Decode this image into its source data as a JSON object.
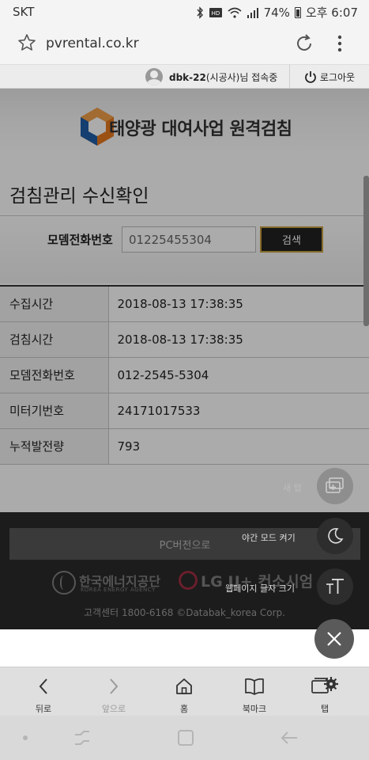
{
  "status_bar": {
    "carrier": "SKT",
    "battery": "74%",
    "time": "오후 6:07"
  },
  "browser": {
    "url": "pvrental.co.kr"
  },
  "user_bar": {
    "user_id": "dbk-22",
    "user_role_suffix": "(시공사)님 접속중",
    "logout_label": "로그아웃"
  },
  "header": {
    "logo_text": "태양광 대여사업 원격검침"
  },
  "page": {
    "title": "검침관리 수신확인"
  },
  "search": {
    "label": "모뎀전화번호",
    "value": "01225455304",
    "button_label": "검색"
  },
  "info_rows": [
    {
      "label": "수집시간",
      "value": "2018-08-13 17:38:35"
    },
    {
      "label": "검침시간",
      "value": "2018-08-13 17:38:35"
    },
    {
      "label": "모뎀전화번호",
      "value": "012-2545-5304"
    },
    {
      "label": "미터기번호",
      "value": "24171017533"
    },
    {
      "label": "누적발전량",
      "value": "793"
    }
  ],
  "footer": {
    "pc_version_label": "PC버전으로",
    "partner1_name": "한국에너지공단",
    "partner1_sub": "KOREA ENERGY AGENCY",
    "partner2_name": "LG U+",
    "partner2_suffix": "컨소시엄",
    "copyright": "고객센터 1800-6168 ©Databak_korea Corp."
  },
  "quick_menu": {
    "new_tab_label": "새 탭",
    "night_mode_label": "야간 모드 켜기",
    "text_size_label": "웹페이지 글자 크기"
  },
  "bottom_nav": {
    "back": "뒤로",
    "forward": "앞으로",
    "home": "홈",
    "bookmarks": "북마크",
    "tabs": "탭"
  },
  "colors": {
    "logo_orange": "#e87a1e",
    "logo_blue": "#1f5fa8",
    "button_dark": "#222222",
    "button_border": "#c8a040",
    "footer_bg": "#1c1c1c"
  }
}
